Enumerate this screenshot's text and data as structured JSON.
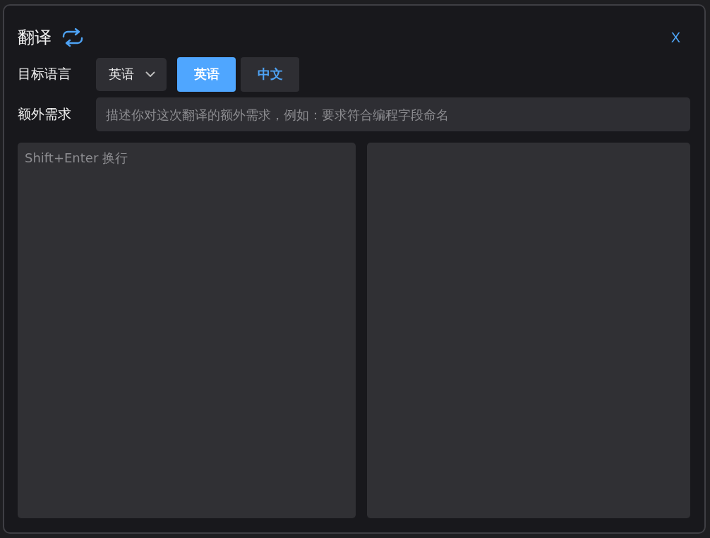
{
  "dialog": {
    "title": "翻译",
    "close": "X"
  },
  "target_language": {
    "label": "目标语言",
    "dropdown": {
      "value": "英语"
    },
    "options": [
      {
        "label": "英语",
        "selected": true
      },
      {
        "label": "中文",
        "selected": false
      }
    ]
  },
  "extra_requirements": {
    "label": "额外需求",
    "placeholder": "描述你对这次翻译的额外需求，例如：要求符合编程字段命名"
  },
  "source": {
    "placeholder": "Shift+Enter 换行"
  }
}
